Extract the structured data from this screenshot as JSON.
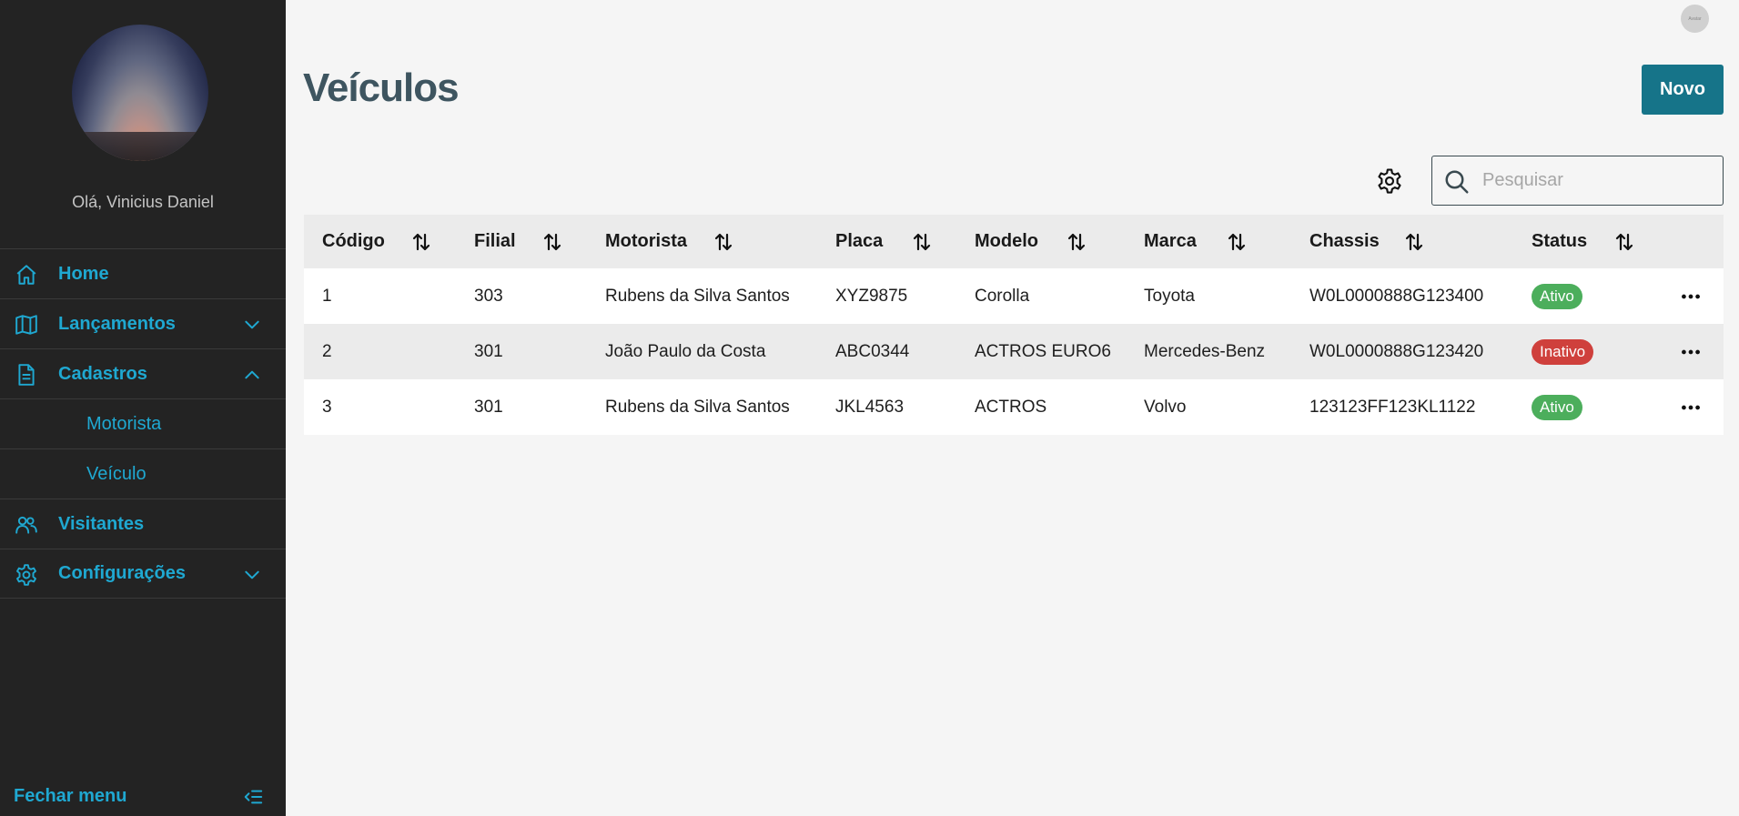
{
  "sidebar": {
    "greeting": "Olá, Vinicius Daniel",
    "items": [
      {
        "label": "Home",
        "icon": "home-icon"
      },
      {
        "label": "Lançamentos",
        "icon": "book-icon",
        "expanded": false
      },
      {
        "label": "Cadastros",
        "icon": "document-icon",
        "expanded": true
      },
      {
        "label": "Motorista"
      },
      {
        "label": "Veículo"
      },
      {
        "label": "Visitantes",
        "icon": "users-icon"
      },
      {
        "label": "Configurações",
        "icon": "gear-icon",
        "expanded": false
      }
    ],
    "close_label": "Fechar menu"
  },
  "header": {
    "user_avatar_text": "Avatar"
  },
  "main": {
    "title": "Veículos",
    "new_button": "Novo",
    "search_placeholder": "Pesquisar"
  },
  "table": {
    "columns": [
      "Código",
      "Filial",
      "Motorista",
      "Placa",
      "Modelo",
      "Marca",
      "Chassis",
      "Status"
    ],
    "rows": [
      {
        "codigo": "1",
        "filial": "303",
        "motorista": "Rubens da Silva Santos",
        "placa": "XYZ9875",
        "modelo": "Corolla",
        "marca": "Toyota",
        "chassis": "W0L0000888G123400",
        "status": "Ativo"
      },
      {
        "codigo": "2",
        "filial": "301",
        "motorista": "João Paulo da Costa",
        "placa": "ABC0344",
        "modelo": "ACTROS EURO6",
        "marca": "Mercedes-Benz",
        "chassis": "W0L0000888G123420",
        "status": "Inativo"
      },
      {
        "codigo": "3",
        "filial": "301",
        "motorista": "Rubens da Silva Santos",
        "placa": "JKL4563",
        "modelo": "ACTROS",
        "marca": "Volvo",
        "chassis": "123123FF123KL1122",
        "status": "Ativo"
      }
    ]
  },
  "colors": {
    "sidebar_bg": "#232323",
    "accent": "#1fa8d1",
    "primary_button": "#167489",
    "status_active": "#4cae5c",
    "status_inactive": "#cf403c"
  }
}
